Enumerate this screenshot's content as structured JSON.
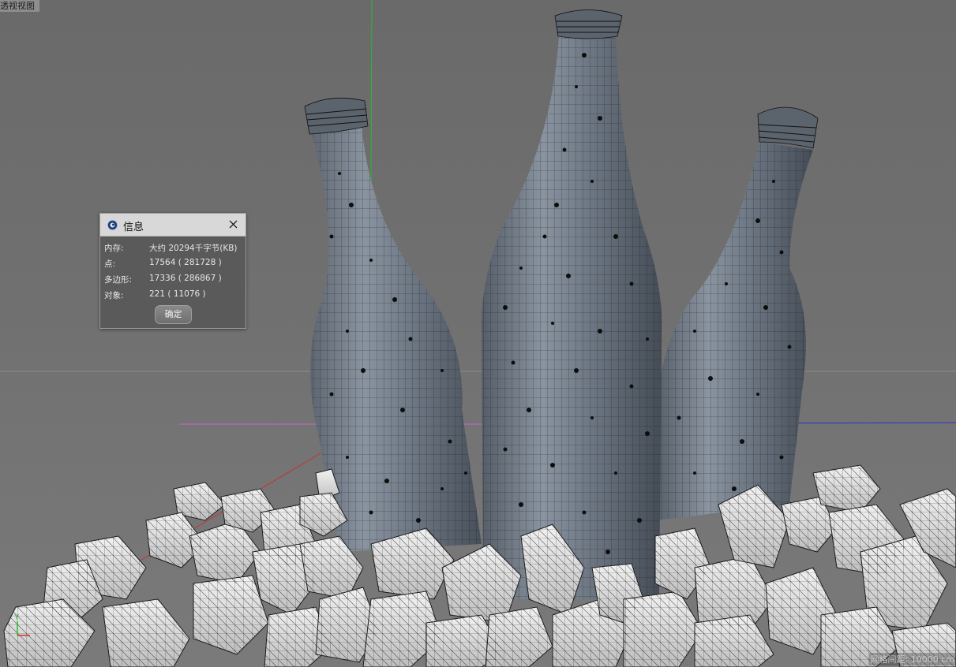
{
  "viewport": {
    "label": "透视视图",
    "status_text": "网格间距: 10000 cm",
    "axis_label": "Y",
    "background": "#6d6d6d"
  },
  "info_dialog": {
    "title": "信息",
    "app_icon": "cinema4d-logo-icon",
    "close_icon": "close-icon",
    "rows": [
      {
        "label": "内存:",
        "value": "大约 20294千字节(KB)"
      },
      {
        "label": "点:",
        "value": "17564 ( 281728 )"
      },
      {
        "label": "多边形:",
        "value": "17336 ( 286867 )"
      },
      {
        "label": "对象:",
        "value": "221 ( 11076 )"
      }
    ],
    "ok_label": "确定"
  },
  "colors": {
    "bottle": "#6f7a86",
    "rock": "#e8e8e8",
    "axis_green": "#2eb82e",
    "axis_red": "#c83232",
    "axis_blue": "#2f2fd0",
    "axis_magenta": "#d060d0"
  }
}
